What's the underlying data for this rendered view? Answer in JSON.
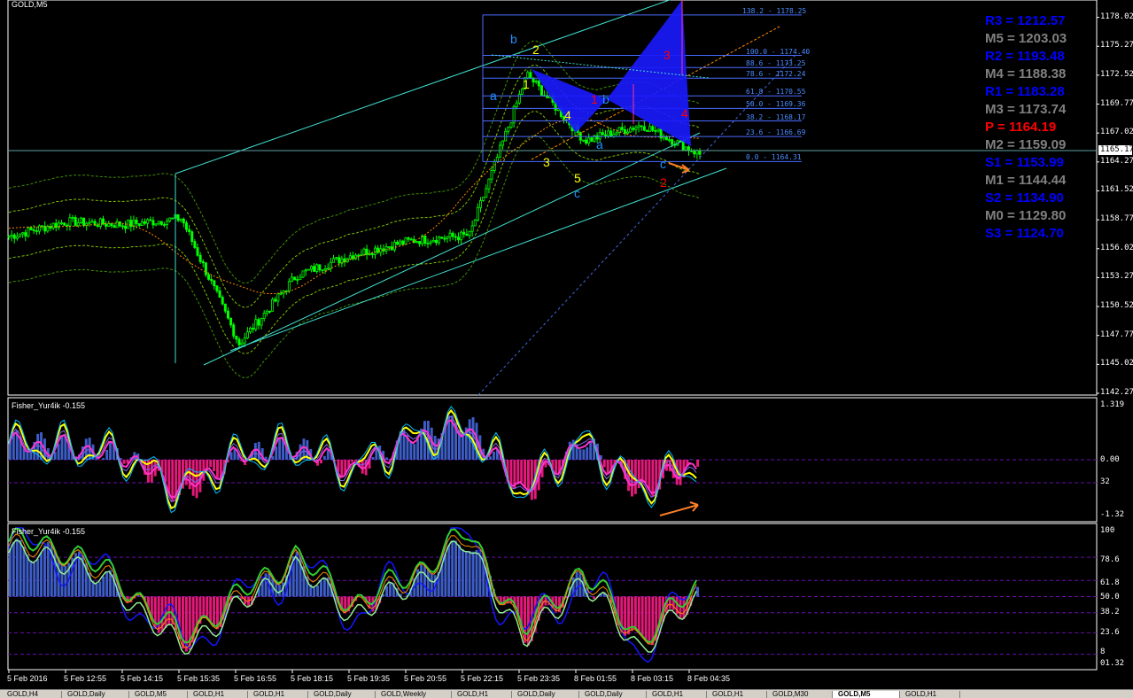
{
  "window": {
    "symbol_title": "GOLD,M5",
    "last_price": "1165.17"
  },
  "main_chart": {
    "price_scale": [
      "1178.02",
      "1175.27",
      "1172.52",
      "1169.77",
      "1167.02",
      "1164.27",
      "1161.52",
      "1158.77",
      "1156.02",
      "1153.27",
      "1150.52",
      "1147.77",
      "1145.02",
      "1142.27"
    ],
    "fibonacci": [
      {
        "label": "138.2 - 1178.25"
      },
      {
        "label": "100.0 - 1174.40"
      },
      {
        "label": "88.6 - 1173.25"
      },
      {
        "label": "78.6 - 1172.24"
      },
      {
        "label": "61.8 - 1170.55"
      },
      {
        "label": "50.0 - 1169.36"
      },
      {
        "label": "38.2 - 1168.17"
      },
      {
        "label": "23.6 - 1166.69"
      },
      {
        "label": "0.0 - 1164.31"
      }
    ],
    "pivots": [
      {
        "label": "R3 = 1212.57",
        "color": "#0000ff"
      },
      {
        "label": "M5 = 1203.03",
        "color": "#808080"
      },
      {
        "label": "R2 = 1193.48",
        "color": "#0000ff"
      },
      {
        "label": "M4 = 1188.38",
        "color": "#808080"
      },
      {
        "label": "R1 = 1183.28",
        "color": "#0000ff"
      },
      {
        "label": "M3 = 1173.74",
        "color": "#808080"
      },
      {
        "label": "P  = 1164.19",
        "color": "#ff0000"
      },
      {
        "label": "M2 = 1159.09",
        "color": "#808080"
      },
      {
        "label": "S1 = 1153.99",
        "color": "#0000ff"
      },
      {
        "label": "M1 = 1144.44",
        "color": "#808080"
      },
      {
        "label": "S2 = 1134.90",
        "color": "#0000ff"
      },
      {
        "label": "M0 = 1129.80",
        "color": "#808080"
      },
      {
        "label": "S3 = 1124.70",
        "color": "#0000ff"
      }
    ],
    "wave_labels": [
      {
        "text": "b",
        "color": "#1e90ff"
      },
      {
        "text": "2",
        "color": "#ffff00"
      },
      {
        "text": "a",
        "color": "#1e90ff"
      },
      {
        "text": "1",
        "color": "#ffff00"
      },
      {
        "text": "1",
        "color": "#ff0000"
      },
      {
        "text": "b",
        "color": "#1e90ff"
      },
      {
        "text": "4",
        "color": "#ffff00"
      },
      {
        "text": "3",
        "color": "#ffff00"
      },
      {
        "text": "a",
        "color": "#1e90ff"
      },
      {
        "text": "5",
        "color": "#ffff00"
      },
      {
        "text": "c",
        "color": "#1e90ff"
      },
      {
        "text": "3",
        "color": "#ff0000"
      },
      {
        "text": "4",
        "color": "#ff0000"
      },
      {
        "text": "c",
        "color": "#1e90ff"
      },
      {
        "text": "2",
        "color": "#ff0000"
      }
    ]
  },
  "chart_data": [
    {
      "type": "line",
      "title": "GOLD,M5",
      "xlabel": "",
      "ylabel": "",
      "ylim": [
        1142.27,
        1179.5
      ],
      "x": [
        "5 Feb 2016",
        "5 Feb 12:55",
        "5 Feb 14:15",
        "5 Feb 15:35",
        "5 Feb 16:55",
        "5 Feb 18:15",
        "5 Feb 19:35",
        "5 Feb 20:55",
        "5 Feb 22:15",
        "5 Feb 23:35",
        "8 Feb 01:55",
        "8 Feb 03:15",
        "8 Feb 04:35"
      ],
      "series": [
        {
          "values": [
            1157.2,
            1158.6,
            1158.3,
            1158.9,
            1147.0,
            1153.5,
            1155.5,
            1156.8,
            1157.3,
            1172.6,
            1166.3,
            1167.8,
            1165.0
          ]
        }
      ]
    },
    {
      "type": "bar",
      "title": "Fisher_Yur4ik -0.155",
      "ylim": [
        -1.32,
        1.319
      ],
      "x": [
        "5 Feb 2016",
        "5 Feb 12:55",
        "5 Feb 14:15",
        "5 Feb 15:35",
        "5 Feb 16:55",
        "5 Feb 18:15",
        "5 Feb 19:35",
        "5 Feb 20:55",
        "5 Feb 22:15",
        "5 Feb 23:35",
        "8 Feb 01:55",
        "8 Feb 03:15",
        "8 Feb 04:35"
      ],
      "series": [
        {
          "values": [
            0.45,
            0.35,
            0.15,
            -0.9,
            0.1,
            0.35,
            -0.3,
            0.6,
            0.9,
            -0.9,
            0.5,
            -0.8,
            -0.155
          ]
        }
      ]
    },
    {
      "type": "bar",
      "title": "Fisher_Yur4ik -0.155",
      "ylim": [
        0,
        100
      ],
      "x": [
        "5 Feb 2016",
        "5 Feb 12:55",
        "5 Feb 14:15",
        "5 Feb 15:35",
        "5 Feb 16:55",
        "5 Feb 18:15",
        "5 Feb 19:35",
        "5 Feb 20:55",
        "5 Feb 22:15",
        "5 Feb 23:35",
        "8 Feb 01:55",
        "8 Feb 03:15",
        "8 Feb 04:35"
      ],
      "series": [
        {
          "values": [
            85,
            80,
            55,
            15,
            45,
            75,
            40,
            60,
            92,
            20,
            65,
            15,
            50
          ]
        }
      ]
    }
  ],
  "indicator1": {
    "title": "Fisher_Yur4ik -0.155",
    "scale": [
      "1.319",
      "0.00",
      "32",
      "-1.32"
    ]
  },
  "indicator2": {
    "title": "Fisher_Yur4ik -0.155",
    "scale": [
      "100",
      "78.6",
      "61.8",
      "50.0",
      "38.2",
      "23.6",
      "8",
      "01.32"
    ]
  },
  "time_axis": [
    "5 Feb 2016",
    "5 Feb 12:55",
    "5 Feb 14:15",
    "5 Feb 15:35",
    "5 Feb 16:55",
    "5 Feb 18:15",
    "5 Feb 19:35",
    "5 Feb 20:55",
    "5 Feb 22:15",
    "5 Feb 23:35",
    "8 Feb 01:55",
    "8 Feb 03:15",
    "8 Feb 04:35"
  ],
  "tabs": [
    {
      "label": "GOLD,H4",
      "active": false
    },
    {
      "label": "GOLD,Daily",
      "active": false
    },
    {
      "label": "GOLD,M5",
      "active": false
    },
    {
      "label": "GOLD,H1",
      "active": false
    },
    {
      "label": "GOLD,H1",
      "active": false
    },
    {
      "label": "GOLD,Daily",
      "active": false
    },
    {
      "label": "GOLD,Weekly",
      "active": false
    },
    {
      "label": "GOLD,H1",
      "active": false
    },
    {
      "label": "GOLD,Daily",
      "active": false
    },
    {
      "label": "GOLD,Daily",
      "active": false
    },
    {
      "label": "GOLD,H1",
      "active": false
    },
    {
      "label": "GOLD,H1",
      "active": false
    },
    {
      "label": "GOLD,M30",
      "active": false
    },
    {
      "label": "GOLD,M5",
      "active": true
    },
    {
      "label": "GOLD,H1",
      "active": false
    }
  ]
}
